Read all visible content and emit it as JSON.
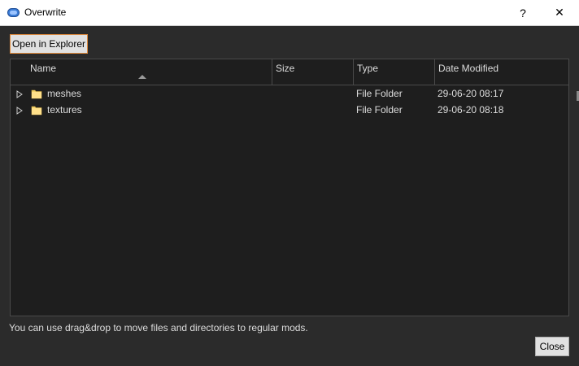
{
  "window": {
    "title": "Overwrite",
    "help_label": "?",
    "close_label": "✕"
  },
  "toolbar": {
    "open_explorer_label": "Open in Explorer"
  },
  "tree": {
    "columns": [
      "Name",
      "Size",
      "Type",
      "Date Modified"
    ],
    "sort_column": "Name",
    "rows": [
      {
        "name": "meshes",
        "size": "",
        "type": "File Folder",
        "date": "29-06-20 08:17"
      },
      {
        "name": "textures",
        "size": "",
        "type": "File Folder",
        "date": "29-06-20 08:18"
      }
    ]
  },
  "hint_text": "You can use drag&drop to move files and directories to regular mods.",
  "footer": {
    "close_label": "Close"
  },
  "colors": {
    "background": "#2b2b2b",
    "tree_background": "#1e1e1e",
    "accent_border": "#e08a3c",
    "folder_yellow": "#f5d36b",
    "app_icon_blue": "#3a7bd5"
  },
  "icons": {
    "app": "mod-organizer-icon",
    "expander": "triangle-right-icon",
    "folder": "folder-icon"
  }
}
